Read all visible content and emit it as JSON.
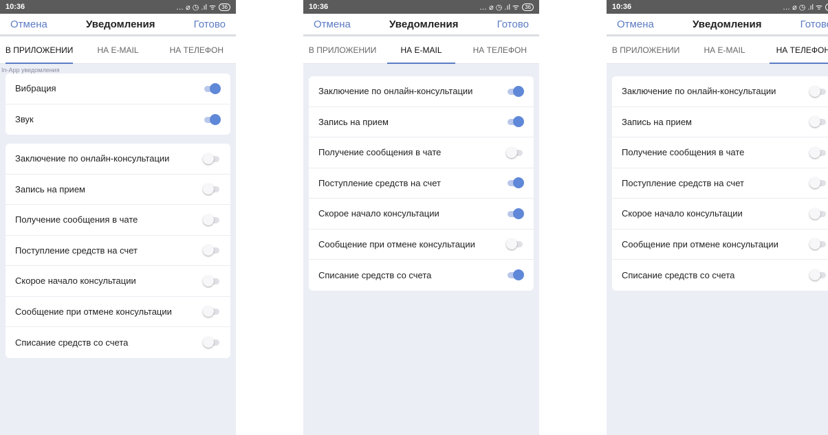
{
  "status": {
    "time": "10:36",
    "icons": "… ⌀ ◷ .ıl ᯤ",
    "battery": "36"
  },
  "nav": {
    "cancel": "Отмена",
    "title": "Уведомления",
    "done": "Готово"
  },
  "tabs": [
    "В ПРИЛОЖЕНИИ",
    "НА E-MAIL",
    "НА ТЕЛЕФОН"
  ],
  "colors": {
    "accent": "#5b7bc4",
    "toggle_on": "#6088d8",
    "background": "#eceef6"
  },
  "screens": [
    {
      "active_tab": 0,
      "section_title": "In-App уведомления",
      "inapp": [
        {
          "label": "Вибрация",
          "on": true
        },
        {
          "label": "Звук",
          "on": true
        }
      ],
      "items": [
        {
          "label": "Заключение по онлайн-консультации",
          "on": false
        },
        {
          "label": "Запись на прием",
          "on": false
        },
        {
          "label": "Получение сообщения в чате",
          "on": false
        },
        {
          "label": "Поступление средств на счет",
          "on": false
        },
        {
          "label": "Скорое начало консультации",
          "on": false
        },
        {
          "label": "Сообщение при отмене консультации",
          "on": false
        },
        {
          "label": "Списание средств со счета",
          "on": false
        }
      ]
    },
    {
      "active_tab": 1,
      "items": [
        {
          "label": "Заключение по онлайн-консультации",
          "on": true
        },
        {
          "label": "Запись на прием",
          "on": true
        },
        {
          "label": "Получение сообщения в чате",
          "on": false
        },
        {
          "label": "Поступление средств на счет",
          "on": true
        },
        {
          "label": "Скорое начало консультации",
          "on": true
        },
        {
          "label": "Сообщение при отмене консультации",
          "on": false
        },
        {
          "label": "Списание средств со счета",
          "on": true
        }
      ]
    },
    {
      "active_tab": 2,
      "items": [
        {
          "label": "Заключение по онлайн-консультации",
          "on": false
        },
        {
          "label": "Запись на прием",
          "on": false
        },
        {
          "label": "Получение сообщения в чате",
          "on": false
        },
        {
          "label": "Поступление средств на счет",
          "on": false
        },
        {
          "label": "Скорое начало консультации",
          "on": false
        },
        {
          "label": "Сообщение при отмене консультации",
          "on": false
        },
        {
          "label": "Списание средств со счета",
          "on": false
        }
      ]
    }
  ]
}
